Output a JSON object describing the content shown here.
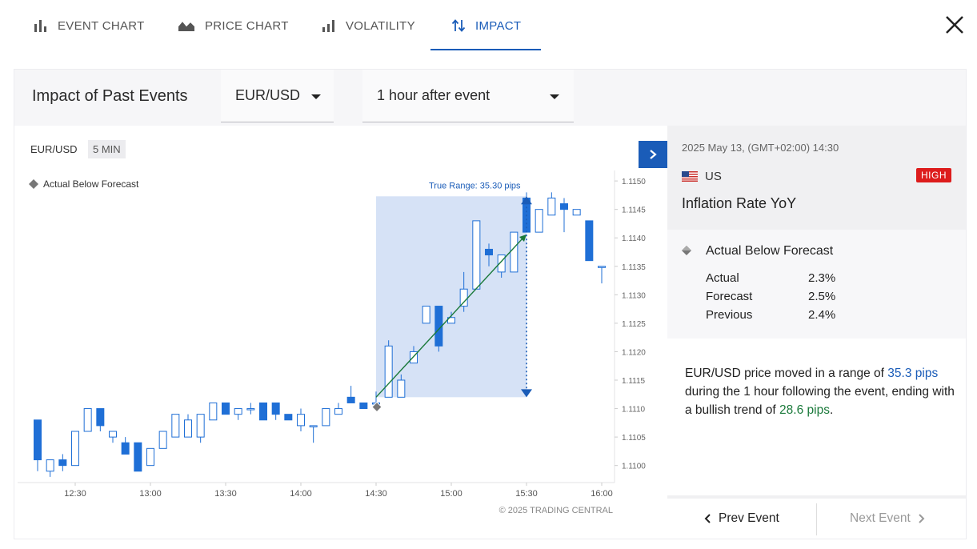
{
  "tabs": [
    {
      "label": "EVENT CHART",
      "icon": "bar-chart-icon"
    },
    {
      "label": "PRICE CHART",
      "icon": "area-chart-icon"
    },
    {
      "label": "VOLATILITY",
      "icon": "volatility-bars-icon"
    },
    {
      "label": "IMPACT",
      "icon": "up-down-arrows-icon",
      "active": true
    }
  ],
  "close_icon": "close-icon",
  "header": {
    "title": "Impact of Past Events",
    "symbol_select": "EUR/USD",
    "window_select": "1 hour after event"
  },
  "chart": {
    "symbol": "EUR/USD",
    "timeframe": "5 MIN",
    "legend": "Actual Below Forecast",
    "range_label": "True Range: 35.30 pips",
    "copyright": "© 2025 TRADING CENTRAL",
    "colors": {
      "up": "#1f6fd6",
      "down": "#1f6fd6",
      "range_fill": "#d6e2f6",
      "arrow": "#1b7a3b",
      "range_marker": "#1a5cb8"
    }
  },
  "chart_data": {
    "type": "candlestick",
    "x_ticks": [
      "12:30",
      "13:00",
      "13:30",
      "14:00",
      "14:30",
      "15:00",
      "15:30",
      "16:00"
    ],
    "y_ticks": [
      "1.1150",
      "1.1145",
      "1.1140",
      "1.1135",
      "1.1130",
      "1.1125",
      "1.1120",
      "1.1115",
      "1.1110",
      "1.1105",
      "1.1100"
    ],
    "ylim": [
      1.1097,
      1.1151
    ],
    "event_time": "14:30",
    "range_window": [
      "14:30",
      "15:30"
    ],
    "range_low": 1.1112,
    "range_high": 1.11473,
    "trend_start": 1.1112,
    "trend_end": 1.11406,
    "candles": [
      {
        "t": "12:15",
        "o": 1.1108,
        "h": 1.1108,
        "l": 1.1099,
        "c": 1.1101
      },
      {
        "t": "12:20",
        "o": 1.1099,
        "h": 1.1101,
        "l": 1.1098,
        "c": 1.1101
      },
      {
        "t": "12:25",
        "o": 1.1101,
        "h": 1.1102,
        "l": 1.1099,
        "c": 1.11
      },
      {
        "t": "12:30",
        "o": 1.11,
        "h": 1.1105,
        "l": 1.11,
        "c": 1.1106
      },
      {
        "t": "12:35",
        "o": 1.1106,
        "h": 1.111,
        "l": 1.1106,
        "c": 1.111
      },
      {
        "t": "12:40",
        "o": 1.111,
        "h": 1.111,
        "l": 1.1106,
        "c": 1.1107
      },
      {
        "t": "12:45",
        "o": 1.1105,
        "h": 1.1106,
        "l": 1.1104,
        "c": 1.1106
      },
      {
        "t": "12:50",
        "o": 1.1104,
        "h": 1.1105,
        "l": 1.1102,
        "c": 1.1102
      },
      {
        "t": "12:55",
        "o": 1.1104,
        "h": 1.1104,
        "l": 1.1099,
        "c": 1.1099
      },
      {
        "t": "13:00",
        "o": 1.11,
        "h": 1.1103,
        "l": 1.11,
        "c": 1.1103
      },
      {
        "t": "13:05",
        "o": 1.1103,
        "h": 1.1106,
        "l": 1.1103,
        "c": 1.1106
      },
      {
        "t": "13:10",
        "o": 1.1105,
        "h": 1.1109,
        "l": 1.1105,
        "c": 1.1109
      },
      {
        "t": "13:15",
        "o": 1.1105,
        "h": 1.1109,
        "l": 1.1105,
        "c": 1.1108
      },
      {
        "t": "13:20",
        "o": 1.1105,
        "h": 1.1109,
        "l": 1.1104,
        "c": 1.1109
      },
      {
        "t": "13:25",
        "o": 1.1108,
        "h": 1.1111,
        "l": 1.1108,
        "c": 1.1111
      },
      {
        "t": "13:30",
        "o": 1.1111,
        "h": 1.1111,
        "l": 1.1109,
        "c": 1.1109
      },
      {
        "t": "13:35",
        "o": 1.1109,
        "h": 1.111,
        "l": 1.1108,
        "c": 1.111
      },
      {
        "t": "13:40",
        "o": 1.111,
        "h": 1.1111,
        "l": 1.1109,
        "c": 1.111
      },
      {
        "t": "13:45",
        "o": 1.1111,
        "h": 1.1111,
        "l": 1.1108,
        "c": 1.1108
      },
      {
        "t": "13:50",
        "o": 1.1111,
        "h": 1.1111,
        "l": 1.1108,
        "c": 1.1109
      },
      {
        "t": "13:55",
        "o": 1.1109,
        "h": 1.1109,
        "l": 1.1108,
        "c": 1.1108
      },
      {
        "t": "14:00",
        "o": 1.1107,
        "h": 1.111,
        "l": 1.1106,
        "c": 1.1109
      },
      {
        "t": "14:05",
        "o": 1.1107,
        "h": 1.1107,
        "l": 1.1104,
        "c": 1.1107
      },
      {
        "t": "14:10",
        "o": 1.1107,
        "h": 1.111,
        "l": 1.1107,
        "c": 1.111
      },
      {
        "t": "14:15",
        "o": 1.1109,
        "h": 1.1111,
        "l": 1.1109,
        "c": 1.111
      },
      {
        "t": "14:20",
        "o": 1.1112,
        "h": 1.1114,
        "l": 1.1111,
        "c": 1.1111
      },
      {
        "t": "14:25",
        "o": 1.1111,
        "h": 1.1111,
        "l": 1.111,
        "c": 1.111
      },
      {
        "t": "14:30",
        "o": 1.1111,
        "h": 1.1113,
        "l": 1.111,
        "c": 1.1111
      },
      {
        "t": "14:35",
        "o": 1.1112,
        "h": 1.1122,
        "l": 1.1112,
        "c": 1.1121
      },
      {
        "t": "14:40",
        "o": 1.1112,
        "h": 1.1116,
        "l": 1.1112,
        "c": 1.1115
      },
      {
        "t": "14:45",
        "o": 1.1118,
        "h": 1.1121,
        "l": 1.1118,
        "c": 1.112
      },
      {
        "t": "14:50",
        "o": 1.1125,
        "h": 1.1128,
        "l": 1.1125,
        "c": 1.1128
      },
      {
        "t": "14:55",
        "o": 1.1128,
        "h": 1.1128,
        "l": 1.112,
        "c": 1.1121
      },
      {
        "t": "15:00",
        "o": 1.1125,
        "h": 1.1127,
        "l": 1.1125,
        "c": 1.1126
      },
      {
        "t": "15:05",
        "o": 1.1128,
        "h": 1.1134,
        "l": 1.1127,
        "c": 1.1131
      },
      {
        "t": "15:10",
        "o": 1.1131,
        "h": 1.1143,
        "l": 1.1131,
        "c": 1.1143
      },
      {
        "t": "15:15",
        "o": 1.1138,
        "h": 1.1139,
        "l": 1.1135,
        "c": 1.1137
      },
      {
        "t": "15:20",
        "o": 1.1134,
        "h": 1.1137,
        "l": 1.1133,
        "c": 1.1137
      },
      {
        "t": "15:25",
        "o": 1.1134,
        "h": 1.1141,
        "l": 1.1134,
        "c": 1.1141
      },
      {
        "t": "15:30",
        "o": 1.1147,
        "h": 1.1148,
        "l": 1.1141,
        "c": 1.1141
      },
      {
        "t": "15:35",
        "o": 1.1141,
        "h": 1.1145,
        "l": 1.1141,
        "c": 1.1145
      },
      {
        "t": "15:40",
        "o": 1.1144,
        "h": 1.1148,
        "l": 1.1144,
        "c": 1.1147
      },
      {
        "t": "15:45",
        "o": 1.1146,
        "h": 1.1147,
        "l": 1.1141,
        "c": 1.1145
      },
      {
        "t": "15:50",
        "o": 1.1144,
        "h": 1.1145,
        "l": 1.1144,
        "c": 1.1145
      },
      {
        "t": "15:55",
        "o": 1.1143,
        "h": 1.1143,
        "l": 1.1136,
        "c": 1.1136
      },
      {
        "t": "16:00",
        "o": 1.1135,
        "h": 1.1135,
        "l": 1.1132,
        "c": 1.1135
      }
    ]
  },
  "event": {
    "datetime": "2025 May 13, (GMT+02:00) 14:30",
    "country": "US",
    "impact": "HIGH",
    "name": "Inflation Rate YoY",
    "outcome": "Actual Below Forecast",
    "stats": [
      {
        "label": "Actual",
        "value": "2.3%"
      },
      {
        "label": "Forecast",
        "value": "2.5%"
      },
      {
        "label": "Previous",
        "value": "2.4%"
      }
    ]
  },
  "summary": {
    "p1": "EUR/USD price moved in a range of ",
    "range": "35.3 pips",
    "p2": " during the 1 hour following the event, ending with a bullish trend of ",
    "trend": "28.6 pips",
    "p3": "."
  },
  "nav": {
    "prev": "Prev Event",
    "next": "Next Event"
  }
}
